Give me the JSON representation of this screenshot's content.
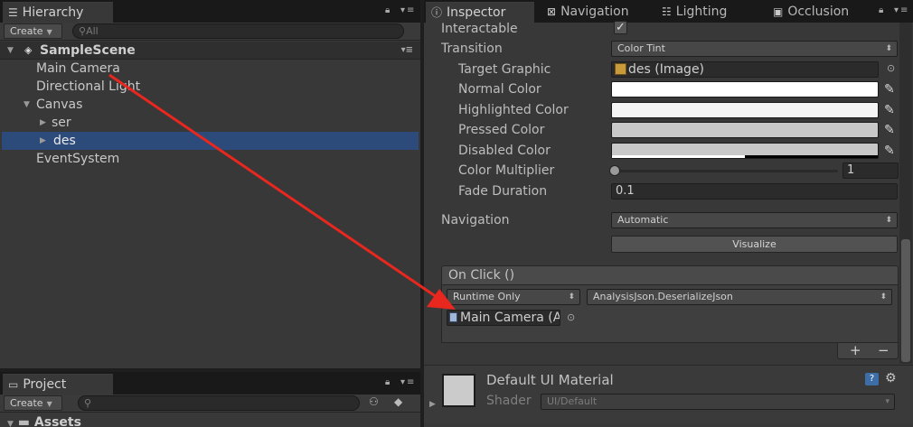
{
  "hierarchy": {
    "tab_label": "Hierarchy",
    "create_label": "Create",
    "search_placeholder": "All",
    "scene_name": "SampleScene",
    "items": [
      {
        "label": "Main Camera"
      },
      {
        "label": "Directional Light"
      },
      {
        "label": "Canvas"
      },
      {
        "label": "ser"
      },
      {
        "label": "des"
      },
      {
        "label": "EventSystem"
      }
    ]
  },
  "project": {
    "tab_label": "Project",
    "create_label": "Create",
    "assets_label": "Assets"
  },
  "inspector": {
    "tabs": [
      {
        "label": "Inspector"
      },
      {
        "label": "Navigation"
      },
      {
        "label": "Lighting"
      },
      {
        "label": "Occlusion"
      }
    ],
    "interactable_label": "Interactable",
    "interactable_checked": true,
    "transition_label": "Transition",
    "transition_value": "Color Tint",
    "target_graphic_label": "Target Graphic",
    "target_graphic_value": "des (Image)",
    "normal_color_label": "Normal Color",
    "highlighted_color_label": "Highlighted Color",
    "pressed_color_label": "Pressed Color",
    "disabled_color_label": "Disabled Color",
    "color_multiplier_label": "Color Multiplier",
    "color_multiplier_value": "1",
    "color_multiplier_level": 0.0,
    "fade_duration_label": "Fade Duration",
    "fade_duration_value": "0.1",
    "navigation_label": "Navigation",
    "navigation_value": "Automatic",
    "visualize_label": "Visualize",
    "onclick": {
      "header": "On Click ()",
      "runtime_value": "Runtime Only",
      "function_value": "AnalysisJson.DeserializeJson",
      "object_value": "Main Camera (A",
      "add_label": "+",
      "remove_label": "−"
    },
    "material": {
      "name": "Default UI Material",
      "shader_label": "Shader",
      "shader_value": "UI/Default"
    }
  },
  "colors": {
    "normal": "#ffffff",
    "highlighted": "#f5f5f5",
    "pressed": "#c8c8c8",
    "disabled": "#c8c8c8",
    "selection": "#2c4a7a",
    "annotation_arrow": "#e8271f"
  }
}
